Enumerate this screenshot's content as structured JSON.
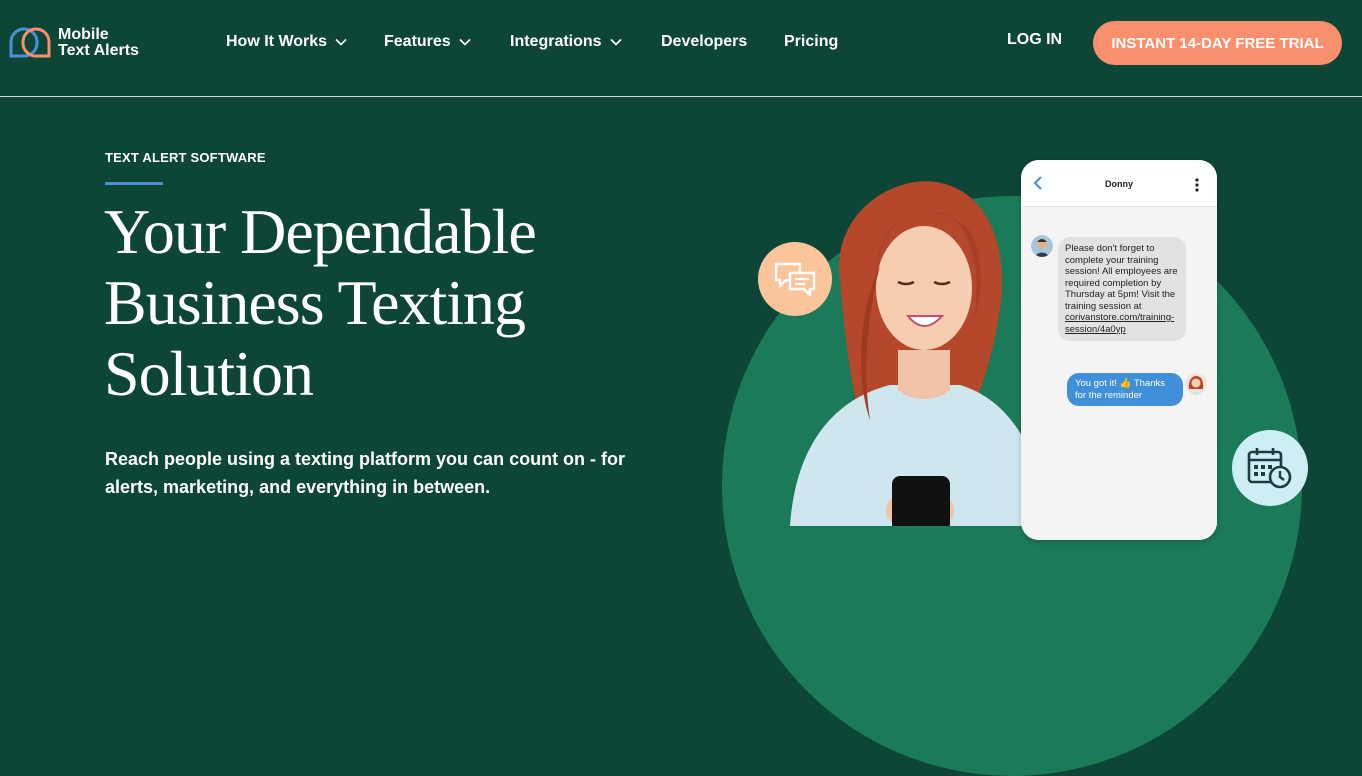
{
  "header": {
    "logo": {
      "line1": "Mobile",
      "line2": "Text Alerts"
    },
    "nav": [
      {
        "label": "How It Works",
        "has_dropdown": true
      },
      {
        "label": "Features",
        "has_dropdown": true
      },
      {
        "label": "Integrations",
        "has_dropdown": true
      },
      {
        "label": "Developers",
        "has_dropdown": false
      },
      {
        "label": "Pricing",
        "has_dropdown": false
      }
    ],
    "login_label": "LOG IN",
    "cta_label": "INSTANT 14-DAY FREE TRIAL"
  },
  "hero": {
    "eyebrow": "TEXT ALERT SOFTWARE",
    "headline": [
      "Your Dependable",
      "Business Texting",
      "Solution"
    ],
    "subtext_lines": [
      "Reach people using a texting platform you can count on - for",
      "alerts, marketing, and everything in between."
    ]
  },
  "phone": {
    "contact_name": "Donny",
    "incoming_message": "Please don't forget to complete your training session! All employees are required completion by Thursday at 5pm! Visit the training session at ",
    "incoming_link": "corivanstore.com/training-session/4a0yp",
    "outgoing_message": "You got it! 👍 Thanks for the reminder"
  },
  "colors": {
    "background": "#0d4536",
    "accent_cta": "#fa8f6e",
    "circle": "#1b7a58",
    "eyebrow_rule": "#4a90d9",
    "outgoing_bubble": "#3f8fd9"
  },
  "icons": [
    "chevron-down-icon",
    "chat-bubbles-icon",
    "calendar-clock-icon",
    "back-arrow-icon",
    "more-vertical-icon"
  ]
}
